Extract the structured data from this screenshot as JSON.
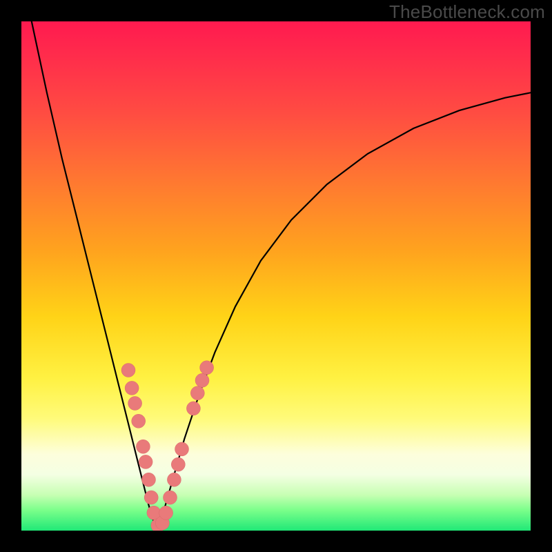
{
  "watermark": "TheBottleneck.com",
  "colors": {
    "frame": "#000000",
    "curve": "#000000",
    "marker": "#e97a7a",
    "marker_stroke": "#d96a6a"
  },
  "chart_data": {
    "type": "line",
    "title": "",
    "xlabel": "",
    "ylabel": "",
    "xlim": [
      0,
      100
    ],
    "ylim": [
      0,
      100
    ],
    "series": [
      {
        "name": "bottleneck-curve",
        "note": "V-shaped bottleneck curve; values are approximate visual estimates (percentages). x is horizontal position, y is vertical height from bottom (0 = bottom, 100 = top).",
        "x": [
          2,
          5,
          8,
          11,
          14,
          17,
          19,
          21,
          23,
          25,
          26.5,
          28,
          30,
          32,
          35,
          38,
          42,
          47,
          53,
          60,
          68,
          77,
          86,
          95,
          100
        ],
        "y": [
          100,
          86,
          73,
          61,
          49,
          37,
          29,
          21,
          13,
          5,
          0,
          4,
          11,
          18,
          27,
          35,
          44,
          53,
          61,
          68,
          74,
          79,
          82.5,
          85,
          86
        ]
      }
    ],
    "markers": {
      "note": "Salmon-colored bead markers clustered near valley on both arms of the V.",
      "points": [
        {
          "x": 21.0,
          "y": 31.5
        },
        {
          "x": 21.7,
          "y": 28.0
        },
        {
          "x": 22.3,
          "y": 25.0
        },
        {
          "x": 23.0,
          "y": 21.5
        },
        {
          "x": 23.9,
          "y": 16.5
        },
        {
          "x": 24.4,
          "y": 13.5
        },
        {
          "x": 25.0,
          "y": 10.0
        },
        {
          "x": 25.5,
          "y": 6.5
        },
        {
          "x": 26.0,
          "y": 3.5
        },
        {
          "x": 26.8,
          "y": 1.0
        },
        {
          "x": 27.7,
          "y": 1.5
        },
        {
          "x": 28.4,
          "y": 3.5
        },
        {
          "x": 29.2,
          "y": 6.5
        },
        {
          "x": 30.0,
          "y": 10.0
        },
        {
          "x": 30.8,
          "y": 13.0
        },
        {
          "x": 31.5,
          "y": 16.0
        },
        {
          "x": 33.8,
          "y": 24.0
        },
        {
          "x": 34.6,
          "y": 27.0
        },
        {
          "x": 35.5,
          "y": 29.5
        },
        {
          "x": 36.4,
          "y": 32.0
        }
      ]
    }
  }
}
